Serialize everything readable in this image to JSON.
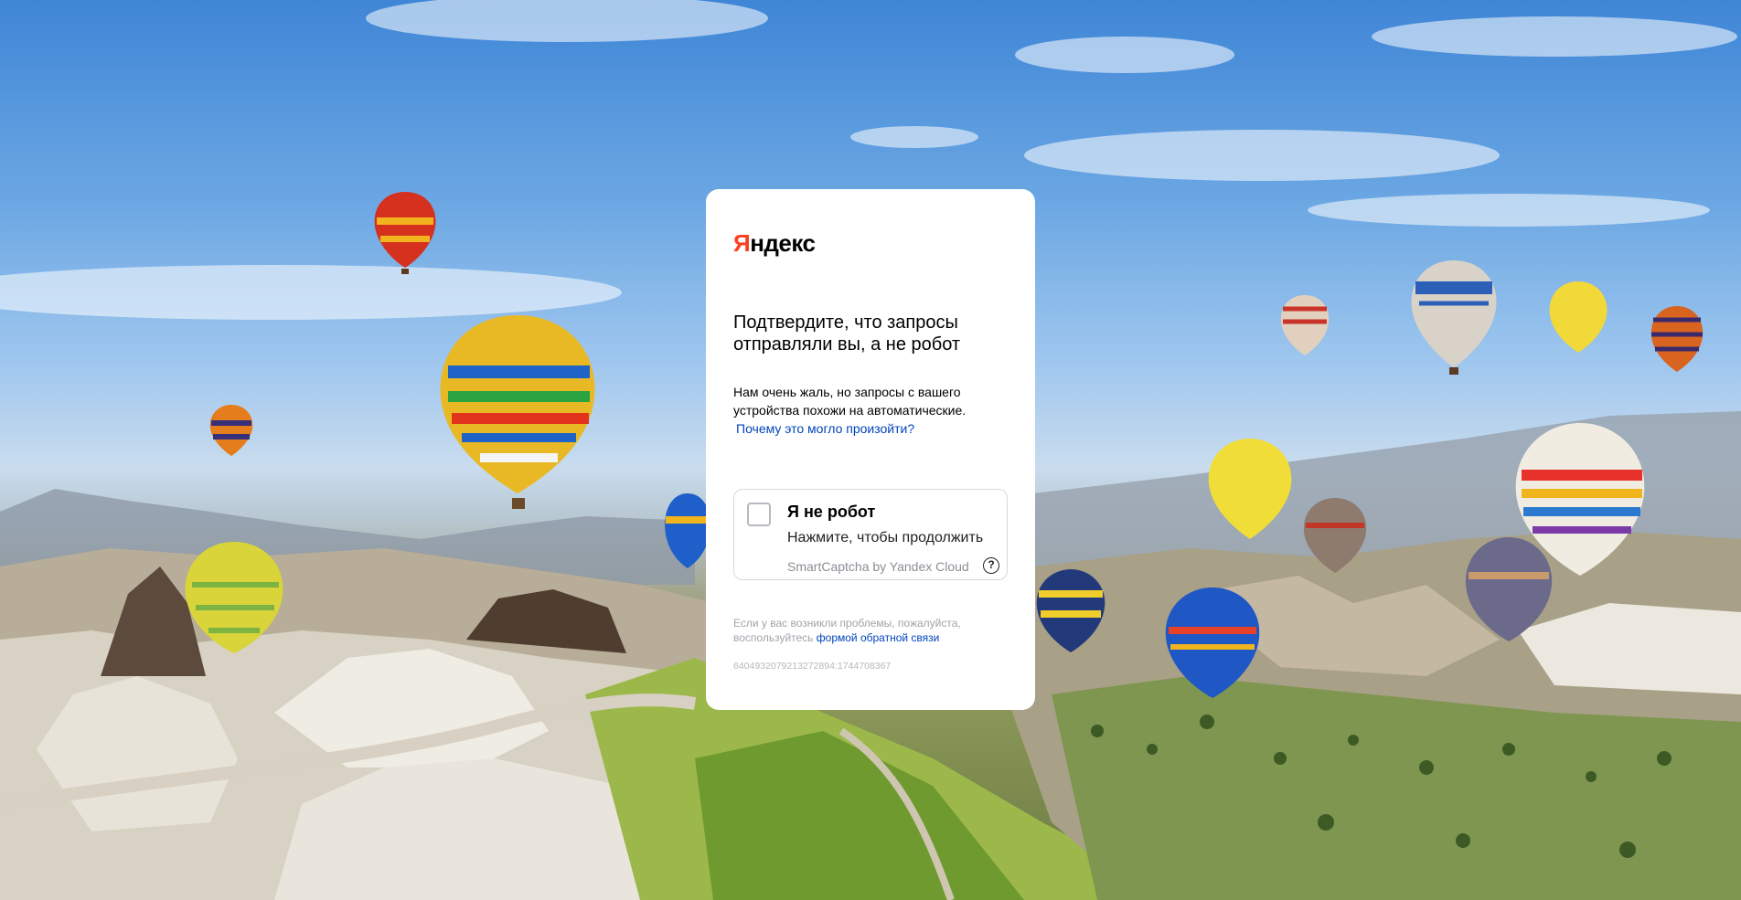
{
  "brand": {
    "logo_first_letter": "Я",
    "logo_rest": "ндекс",
    "accent_color": "#fc3f1d"
  },
  "heading": "Подтвердите, что запросы отправляли вы, а не робот",
  "description": "Нам очень жаль, но запросы с вашего устройства похожи на автоматические.",
  "why_link": "Почему это могло произойти?",
  "captcha": {
    "checkbox_label": "Я не робот",
    "hint": "Нажмите, чтобы продолжить",
    "provider": "SmartCaptcha by Yandex Cloud",
    "help_icon": "?"
  },
  "feedback": {
    "text": "Если у вас возникли проблемы, пожалуйста, воспользуйтесь",
    "link": "формой обратной связи"
  },
  "request_token": "6404932079213272894:1744708367",
  "background": {
    "theme": "hot air balloons over Cappadocia valley",
    "sky_color": "#5a9be0",
    "link_color": "#0044bb"
  }
}
